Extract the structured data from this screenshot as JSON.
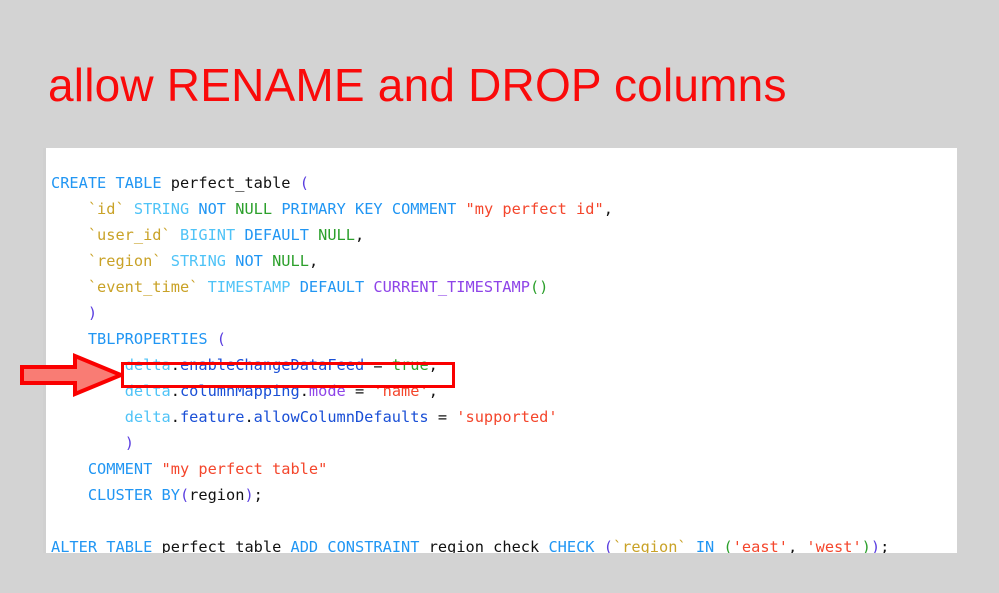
{
  "slide": {
    "title": "allow RENAME and DROP columns",
    "title_color": "#fa0a0a",
    "background_color": "#d3d3d3"
  },
  "code_block": {
    "language": "sql",
    "background_color": "#ffffff",
    "lines": [
      {
        "indent": 0,
        "tokens": [
          {
            "text": "CREATE",
            "type": "keyword"
          },
          {
            "text": " ",
            "type": "space"
          },
          {
            "text": "TABLE",
            "type": "keyword"
          },
          {
            "text": " ",
            "type": "space"
          },
          {
            "text": "perfect_table",
            "type": "identifier"
          },
          {
            "text": " ",
            "type": "space"
          },
          {
            "text": "(",
            "type": "paren1"
          }
        ]
      },
      {
        "indent": 1,
        "tokens": [
          {
            "text": "`id`",
            "type": "backtick"
          },
          {
            "text": " ",
            "type": "space"
          },
          {
            "text": "STRING",
            "type": "type"
          },
          {
            "text": " ",
            "type": "space"
          },
          {
            "text": "NOT",
            "type": "keyword"
          },
          {
            "text": " ",
            "type": "space"
          },
          {
            "text": "NULL",
            "type": "null"
          },
          {
            "text": " ",
            "type": "space"
          },
          {
            "text": "PRIMARY",
            "type": "keyword"
          },
          {
            "text": " ",
            "type": "space"
          },
          {
            "text": "KEY",
            "type": "keyword"
          },
          {
            "text": " ",
            "type": "space"
          },
          {
            "text": "COMMENT",
            "type": "keyword"
          },
          {
            "text": " ",
            "type": "space"
          },
          {
            "text": "\"my perfect id\"",
            "type": "string"
          },
          {
            "text": ",",
            "type": "punct"
          }
        ]
      },
      {
        "indent": 1,
        "tokens": [
          {
            "text": "`user_id`",
            "type": "backtick"
          },
          {
            "text": " ",
            "type": "space"
          },
          {
            "text": "BIGINT",
            "type": "type"
          },
          {
            "text": " ",
            "type": "space"
          },
          {
            "text": "DEFAULT",
            "type": "keyword"
          },
          {
            "text": " ",
            "type": "space"
          },
          {
            "text": "NULL",
            "type": "null"
          },
          {
            "text": ",",
            "type": "punct"
          }
        ]
      },
      {
        "indent": 1,
        "tokens": [
          {
            "text": "`region`",
            "type": "backtick"
          },
          {
            "text": " ",
            "type": "space"
          },
          {
            "text": "STRING",
            "type": "type"
          },
          {
            "text": " ",
            "type": "space"
          },
          {
            "text": "NOT",
            "type": "keyword"
          },
          {
            "text": " ",
            "type": "space"
          },
          {
            "text": "NULL",
            "type": "null"
          },
          {
            "text": ",",
            "type": "punct"
          }
        ]
      },
      {
        "indent": 1,
        "tokens": [
          {
            "text": "`event_time`",
            "type": "backtick"
          },
          {
            "text": " ",
            "type": "space"
          },
          {
            "text": "TIMESTAMP",
            "type": "type"
          },
          {
            "text": " ",
            "type": "space"
          },
          {
            "text": "DEFAULT",
            "type": "keyword"
          },
          {
            "text": " ",
            "type": "space"
          },
          {
            "text": "CURRENT_TIMESTAMP",
            "type": "function"
          },
          {
            "text": "(",
            "type": "paren2"
          },
          {
            "text": ")",
            "type": "paren2"
          }
        ]
      },
      {
        "indent": 1,
        "tokens": [
          {
            "text": ")",
            "type": "paren1"
          }
        ]
      },
      {
        "indent": 1,
        "tokens": [
          {
            "text": "TBLPROPERTIES",
            "type": "keyword"
          },
          {
            "text": " ",
            "type": "space"
          },
          {
            "text": "(",
            "type": "paren1"
          }
        ]
      },
      {
        "indent": 2,
        "tokens": [
          {
            "text": "delta",
            "type": "prop-ns"
          },
          {
            "text": ".",
            "type": "punct"
          },
          {
            "text": "enableChangeDataFeed",
            "type": "prop"
          },
          {
            "text": " ",
            "type": "space"
          },
          {
            "text": "=",
            "type": "op"
          },
          {
            "text": " ",
            "type": "space"
          },
          {
            "text": "true",
            "type": "null"
          },
          {
            "text": ",",
            "type": "punct"
          }
        ]
      },
      {
        "indent": 2,
        "highlighted": true,
        "tokens": [
          {
            "text": "delta",
            "type": "prop-ns"
          },
          {
            "text": ".",
            "type": "punct"
          },
          {
            "text": "columnMapping",
            "type": "prop"
          },
          {
            "text": ".",
            "type": "punct"
          },
          {
            "text": "mode",
            "type": "prop-sub"
          },
          {
            "text": " ",
            "type": "space"
          },
          {
            "text": "=",
            "type": "op"
          },
          {
            "text": " ",
            "type": "space"
          },
          {
            "text": "'name'",
            "type": "string"
          },
          {
            "text": ",",
            "type": "punct"
          }
        ]
      },
      {
        "indent": 2,
        "tokens": [
          {
            "text": "delta",
            "type": "prop-ns"
          },
          {
            "text": ".",
            "type": "punct"
          },
          {
            "text": "feature",
            "type": "prop"
          },
          {
            "text": ".",
            "type": "punct"
          },
          {
            "text": "allowColumnDefaults",
            "type": "prop"
          },
          {
            "text": " ",
            "type": "space"
          },
          {
            "text": "=",
            "type": "op"
          },
          {
            "text": " ",
            "type": "space"
          },
          {
            "text": "'supported'",
            "type": "string"
          }
        ]
      },
      {
        "indent": 2,
        "tokens": [
          {
            "text": ")",
            "type": "paren1"
          }
        ]
      },
      {
        "indent": 1,
        "tokens": [
          {
            "text": "COMMENT",
            "type": "keyword"
          },
          {
            "text": " ",
            "type": "space"
          },
          {
            "text": "\"my perfect table\"",
            "type": "string"
          }
        ]
      },
      {
        "indent": 1,
        "tokens": [
          {
            "text": "CLUSTER",
            "type": "keyword"
          },
          {
            "text": " ",
            "type": "space"
          },
          {
            "text": "BY",
            "type": "keyword"
          },
          {
            "text": "(",
            "type": "paren1"
          },
          {
            "text": "region",
            "type": "identifier"
          },
          {
            "text": ")",
            "type": "paren1"
          },
          {
            "text": ";",
            "type": "punct"
          }
        ]
      },
      {
        "indent": 0,
        "tokens": []
      },
      {
        "indent": 0,
        "tokens": [
          {
            "text": "ALTER",
            "type": "keyword"
          },
          {
            "text": " ",
            "type": "space"
          },
          {
            "text": "TABLE",
            "type": "keyword"
          },
          {
            "text": " ",
            "type": "space"
          },
          {
            "text": "perfect_table",
            "type": "identifier"
          },
          {
            "text": " ",
            "type": "space"
          },
          {
            "text": "ADD",
            "type": "keyword"
          },
          {
            "text": " ",
            "type": "space"
          },
          {
            "text": "CONSTRAINT",
            "type": "keyword"
          },
          {
            "text": " ",
            "type": "space"
          },
          {
            "text": "region_check",
            "type": "identifier"
          },
          {
            "text": " ",
            "type": "space"
          },
          {
            "text": "CHECK",
            "type": "keyword"
          },
          {
            "text": " ",
            "type": "space"
          },
          {
            "text": "(",
            "type": "paren1"
          },
          {
            "text": "`region`",
            "type": "backtick"
          },
          {
            "text": " ",
            "type": "space"
          },
          {
            "text": "IN",
            "type": "keyword"
          },
          {
            "text": " ",
            "type": "space"
          },
          {
            "text": "(",
            "type": "paren2"
          },
          {
            "text": "'east'",
            "type": "string"
          },
          {
            "text": ",",
            "type": "punct"
          },
          {
            "text": " ",
            "type": "space"
          },
          {
            "text": "'west'",
            "type": "string"
          },
          {
            "text": ")",
            "type": "paren2"
          },
          {
            "text": ")",
            "type": "paren1"
          },
          {
            "text": ";",
            "type": "punct"
          }
        ]
      }
    ]
  },
  "annotations": {
    "highlight_box": {
      "target_text": "delta.columnMapping.mode = 'name'",
      "border_color": "#fa0000"
    },
    "arrow": {
      "direction": "right",
      "outline_color": "#fa0000",
      "fill_color": "#f97c74",
      "points_to": "delta.columnMapping.mode = 'name'"
    }
  }
}
